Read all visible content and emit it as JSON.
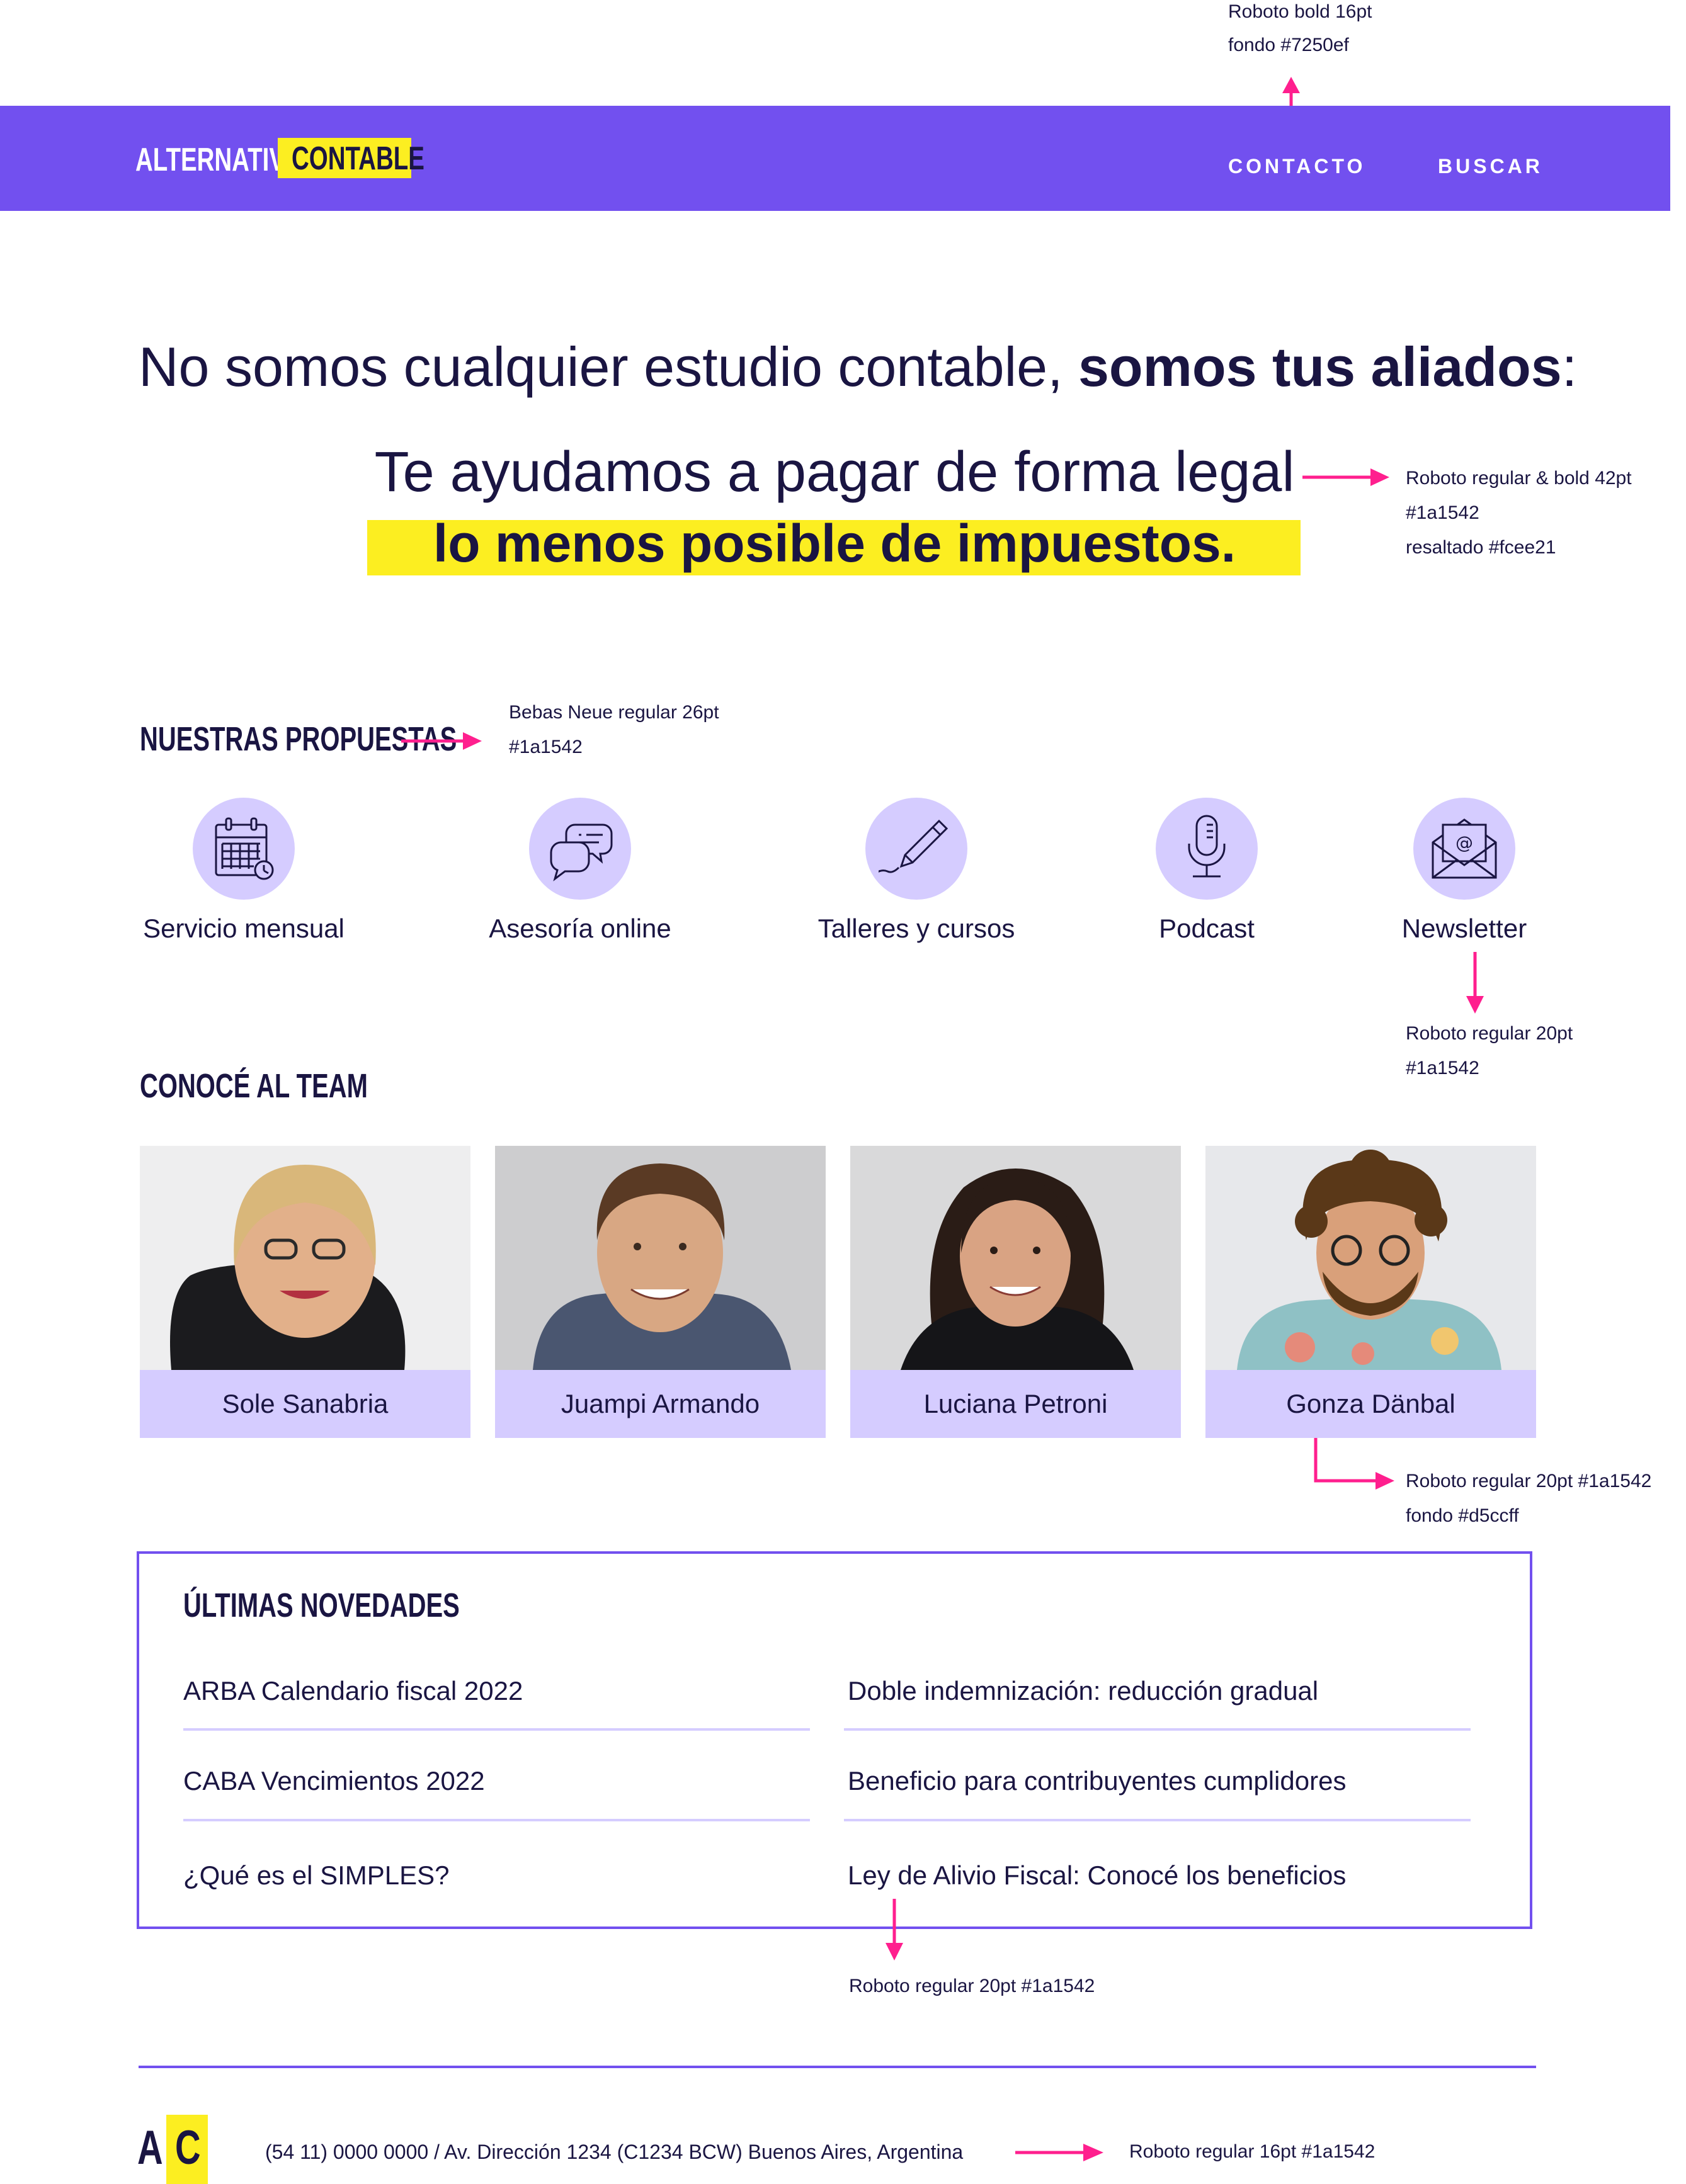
{
  "header": {
    "logo_part1": "ALTERNATIVA",
    "logo_part2": "CONTABLE",
    "nav": [
      "CONTACTO",
      "BUSCAR"
    ]
  },
  "hero": {
    "title_regular": "No somos cualquier estudio contable, ",
    "title_bold": "somos tus aliados",
    "title_end": ":",
    "line1": "Te ayudamos a pagar de forma legal",
    "line2": "lo menos posible de impuestos."
  },
  "services": {
    "title": "NUESTRAS PROPUESTAS",
    "items": [
      {
        "label": "Servicio mensual",
        "icon": "calendar-icon"
      },
      {
        "label": "Asesoría online",
        "icon": "chat-bubbles-icon"
      },
      {
        "label": "Talleres y cursos",
        "icon": "pencil-icon"
      },
      {
        "label": "Podcast",
        "icon": "microphone-icon"
      },
      {
        "label": "Newsletter",
        "icon": "envelope-icon"
      }
    ]
  },
  "team": {
    "title": "CONOCÉ AL TEAM",
    "members": [
      "Sole Sanabria",
      "Juampi Armando",
      "Luciana Petroni",
      "Gonza Dänbal"
    ]
  },
  "news": {
    "title": "ÚLTIMAS NOVEDADES",
    "left": [
      "ARBA Calendario fiscal 2022",
      "CABA Vencimientos 2022",
      "¿Qué es el SIMPLES?"
    ],
    "right": [
      "Doble indemnización: reducción gradual",
      "Beneficio para contribuyentes cumplidores",
      "Ley de Alivio Fiscal: Conocé los beneficios"
    ]
  },
  "footer": {
    "logo_a": "A",
    "logo_c": "C",
    "text": "(54 11) 0000 0000 / Av. Dirección 1234 (C1234 BCW) Buenos Aires, Argentina"
  },
  "annotations": {
    "nav_1": "Roboto bold 16pt",
    "nav_2": "fondo #7250ef",
    "hero_1": "Roboto regular & bold 42pt",
    "hero_2": "#1a1542",
    "hero_3": "resaltado #fcee21",
    "section_1": "Bebas Neue regular 26pt",
    "section_2": "#1a1542",
    "service_1": "Roboto regular 20pt",
    "service_2": "#1a1542",
    "team_1": "Roboto regular 20pt #1a1542",
    "team_2": "fondo #d5ccff",
    "news_1": "Roboto regular 20pt #1a1542",
    "footer_1": "Roboto regular 16pt #1a1542"
  },
  "colors": {
    "primary": "#7250ef",
    "text": "#1a1542",
    "highlight": "#fcee21",
    "light": "#d5ccff",
    "annotation_arrow": "#ff1f8e"
  }
}
